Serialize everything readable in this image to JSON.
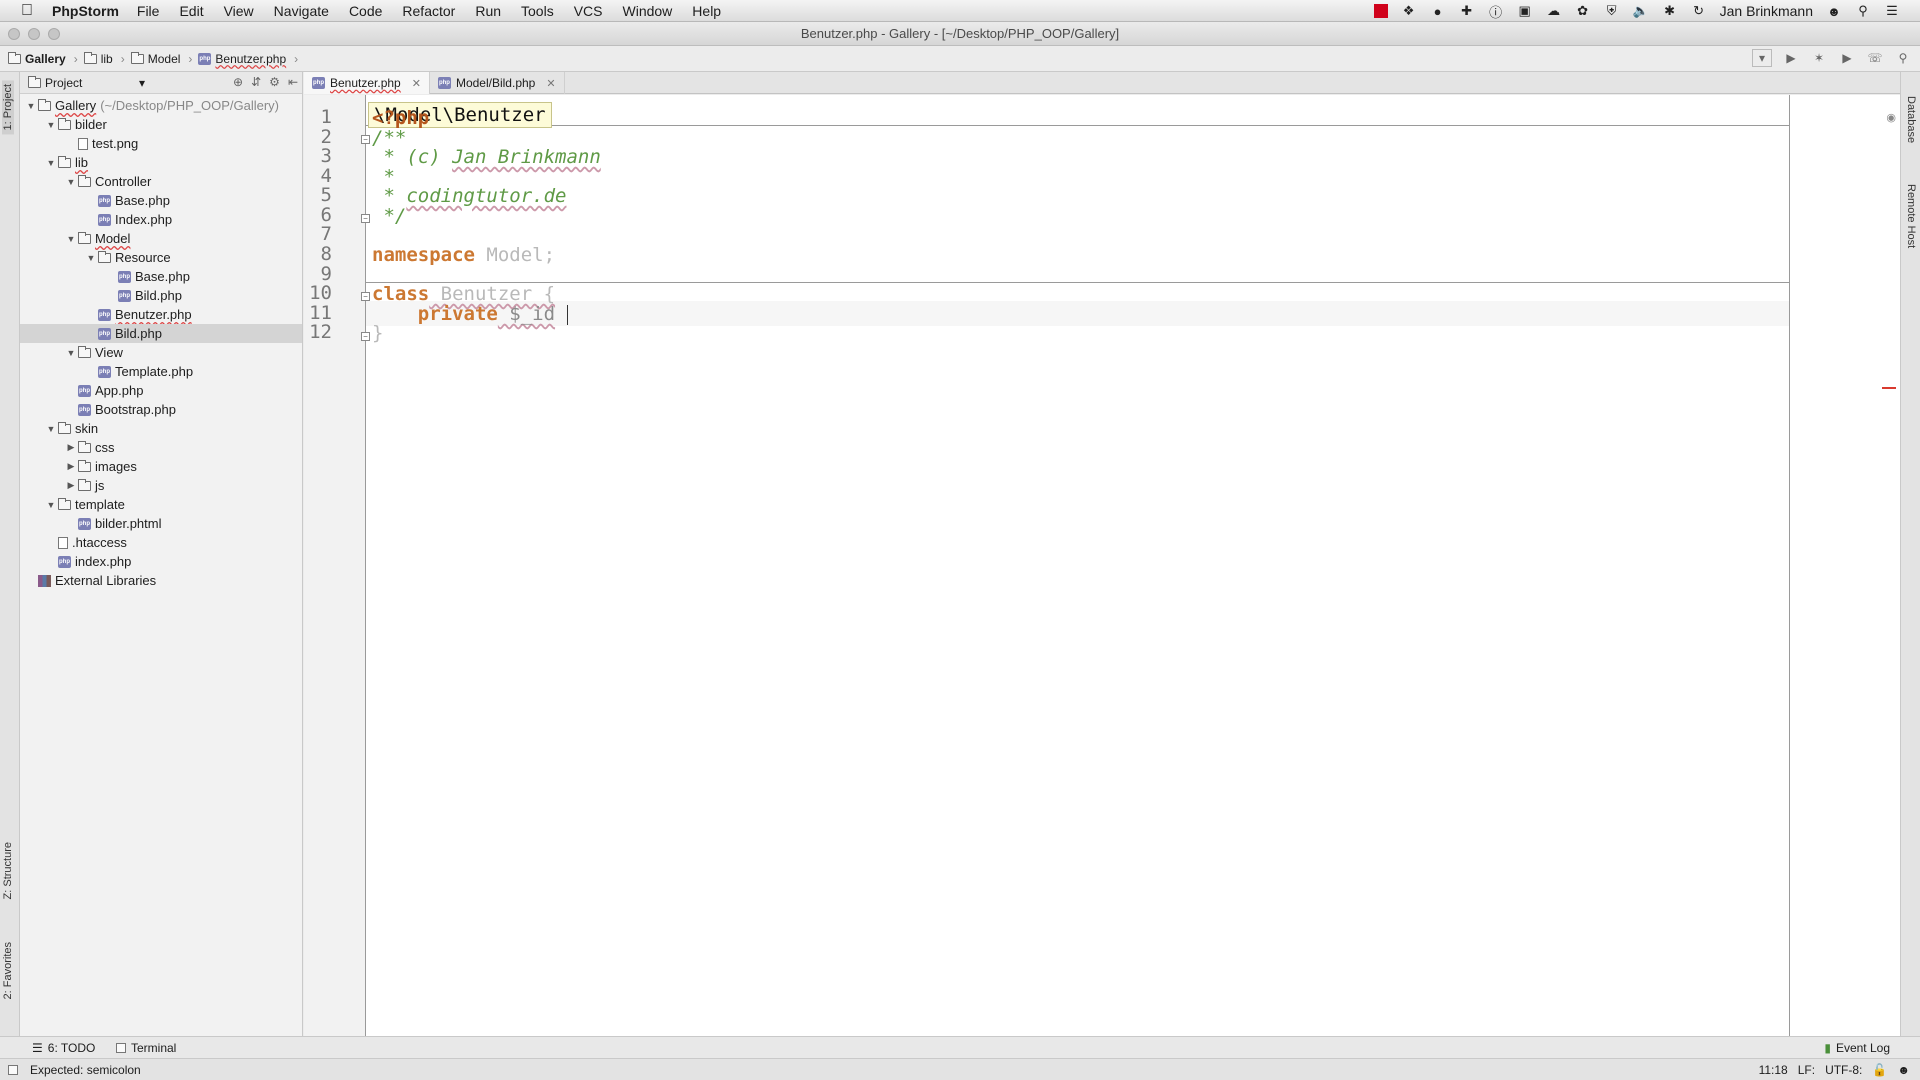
{
  "menubar": {
    "app_name": "PhpStorm",
    "items": [
      "File",
      "Edit",
      "View",
      "Navigate",
      "Code",
      "Refactor",
      "Run",
      "Tools",
      "VCS",
      "Window",
      "Help"
    ],
    "user": "Jan Brinkmann"
  },
  "window": {
    "title": "Benutzer.php - Gallery - [~/Desktop/PHP_OOP/Gallery]"
  },
  "breadcrumb": [
    "Gallery",
    "lib",
    "Model",
    "Benutzer.php"
  ],
  "project_panel": {
    "title": "Project",
    "tree": [
      {
        "label": "Gallery",
        "path": "(~/Desktop/PHP_OOP/Gallery)",
        "type": "folder",
        "depth": 0,
        "open": true
      },
      {
        "label": "bilder",
        "type": "folder",
        "depth": 1,
        "open": true
      },
      {
        "label": "test.png",
        "type": "file",
        "depth": 2
      },
      {
        "label": "lib",
        "type": "folder",
        "depth": 1,
        "open": true
      },
      {
        "label": "Controller",
        "type": "folder",
        "depth": 2,
        "open": true
      },
      {
        "label": "Base.php",
        "type": "php",
        "depth": 3
      },
      {
        "label": "Index.php",
        "type": "php",
        "depth": 3
      },
      {
        "label": "Model",
        "type": "folder",
        "depth": 2,
        "open": true
      },
      {
        "label": "Resource",
        "type": "folder",
        "depth": 3,
        "open": true
      },
      {
        "label": "Base.php",
        "type": "php",
        "depth": 4
      },
      {
        "label": "Bild.php",
        "type": "php",
        "depth": 4
      },
      {
        "label": "Benutzer.php",
        "type": "php",
        "depth": 3
      },
      {
        "label": "Bild.php",
        "type": "php",
        "depth": 3,
        "selected": true
      },
      {
        "label": "View",
        "type": "folder",
        "depth": 2,
        "open": true
      },
      {
        "label": "Template.php",
        "type": "php",
        "depth": 3
      },
      {
        "label": "App.php",
        "type": "php",
        "depth": 2
      },
      {
        "label": "Bootstrap.php",
        "type": "php",
        "depth": 2
      },
      {
        "label": "skin",
        "type": "folder",
        "depth": 1,
        "open": true
      },
      {
        "label": "css",
        "type": "folder",
        "depth": 2,
        "open": false
      },
      {
        "label": "images",
        "type": "folder",
        "depth": 2,
        "open": false
      },
      {
        "label": "js",
        "type": "folder",
        "depth": 2,
        "open": false
      },
      {
        "label": "template",
        "type": "folder",
        "depth": 1,
        "open": true
      },
      {
        "label": "bilder.phtml",
        "type": "php",
        "depth": 2
      },
      {
        "label": ".htaccess",
        "type": "file",
        "depth": 1
      },
      {
        "label": "index.php",
        "type": "php",
        "depth": 1
      },
      {
        "label": "External Libraries",
        "type": "lib",
        "depth": 0
      }
    ]
  },
  "tabs": [
    {
      "label": "Benutzer.php",
      "active": true
    },
    {
      "label": "Model/Bild.php",
      "active": false
    }
  ],
  "editor": {
    "scope_hint": "\\Model\\Benutzer",
    "line_numbers": [
      "1",
      "2",
      "3",
      "4",
      "5",
      "6",
      "7",
      "8",
      "9",
      "10",
      "11",
      "12"
    ],
    "lines": {
      "l1": "<?php",
      "l2": "/**",
      "l3a": " * (c) ",
      "l3b": "Jan Brinkmann",
      "l4": " *",
      "l5a": " * ",
      "l5b": "codingtutor.de",
      "l6": " */",
      "l8kw": "namespace",
      "l8id": " Model;",
      "l10kw": "class",
      "l10id": " Benutzer {",
      "l11kw": "    private",
      "l11var": " $_id",
      "l12": "}"
    }
  },
  "left_stripe": {
    "project_tab": "1: Project",
    "structure_tab": "Z: Structure",
    "favorites_tab": "2: Favorites"
  },
  "right_stripe": {
    "database_tab": "Database",
    "remote_tab": "Remote Host"
  },
  "bottom_tools": {
    "todo": "6: TODO",
    "terminal": "Terminal",
    "event_log": "Event Log"
  },
  "status": {
    "message": "Expected: semicolon",
    "position": "11:18",
    "line_sep": "LF:",
    "encoding": "UTF-8:"
  }
}
